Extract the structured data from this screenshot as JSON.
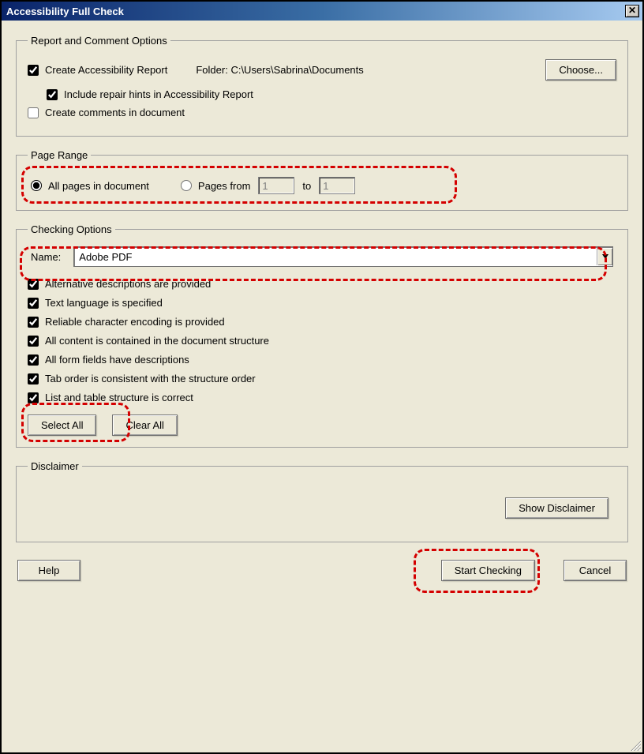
{
  "window": {
    "title": "Accessibility Full Check"
  },
  "report": {
    "legend": "Report and Comment Options",
    "create_report_label": "Create Accessibility Report",
    "create_report_checked": true,
    "folder_label": "Folder:",
    "folder_path": "C:\\Users\\Sabrina\\Documents",
    "choose_button": "Choose...",
    "include_hints_label": "Include repair hints in Accessibility Report",
    "include_hints_checked": true,
    "create_comments_label": "Create comments in document",
    "create_comments_checked": false
  },
  "page_range": {
    "legend": "Page Range",
    "all_pages_label": "All pages in document",
    "all_pages_selected": true,
    "pages_from_label": "Pages from",
    "pages_from_selected": false,
    "from_value": "1",
    "to_label": "to",
    "to_value": "1"
  },
  "checking": {
    "legend": "Checking Options",
    "name_label": "Name:",
    "name_value": "Adobe PDF",
    "options": [
      {
        "label": "Alternative descriptions are provided",
        "checked": true
      },
      {
        "label": "Text language is specified",
        "checked": true
      },
      {
        "label": "Reliable character encoding is provided",
        "checked": true
      },
      {
        "label": "All content is contained in the document structure",
        "checked": true
      },
      {
        "label": "All form fields have descriptions",
        "checked": true
      },
      {
        "label": "Tab order is consistent with the structure order",
        "checked": true
      },
      {
        "label": "List and table structure is correct",
        "checked": true
      }
    ],
    "select_all": "Select All",
    "clear_all": "Clear All"
  },
  "disclaimer": {
    "legend": "Disclaimer",
    "show_button": "Show Disclaimer"
  },
  "buttons": {
    "help": "Help",
    "start": "Start Checking",
    "cancel": "Cancel"
  }
}
